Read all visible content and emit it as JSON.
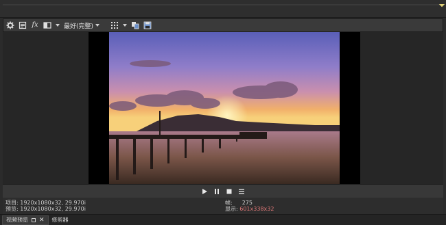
{
  "toolbar": {
    "icons": [
      "gear-icon",
      "preview-settings-icon",
      "fx-icon",
      "split-screen-icon",
      "grid-icon",
      "copy-snapshot-icon",
      "save-snapshot-icon"
    ],
    "fx_label": "fx",
    "quality_select": "最好(完整)"
  },
  "transport": {
    "buttons": [
      "play-icon",
      "pause-icon",
      "stop-icon",
      "menu-icon"
    ]
  },
  "info": {
    "project_label": "项目:",
    "project_value": "1920x1080x32, 29.970i",
    "preview_label": "预览:",
    "preview_value": "1920x1080x32, 29.970i",
    "frame_label": "帧:",
    "frame_value": "275",
    "display_label": "显示:",
    "display_value": "601x338x32",
    "display_value_color": "#e07878"
  },
  "tabs": [
    {
      "label": "视频预览",
      "active": true
    },
    {
      "label": "修剪器",
      "active": false
    }
  ],
  "colors": {
    "background": "#2b2b2b",
    "toolbar": "#3a3a3a",
    "letterbox": "#000000"
  }
}
